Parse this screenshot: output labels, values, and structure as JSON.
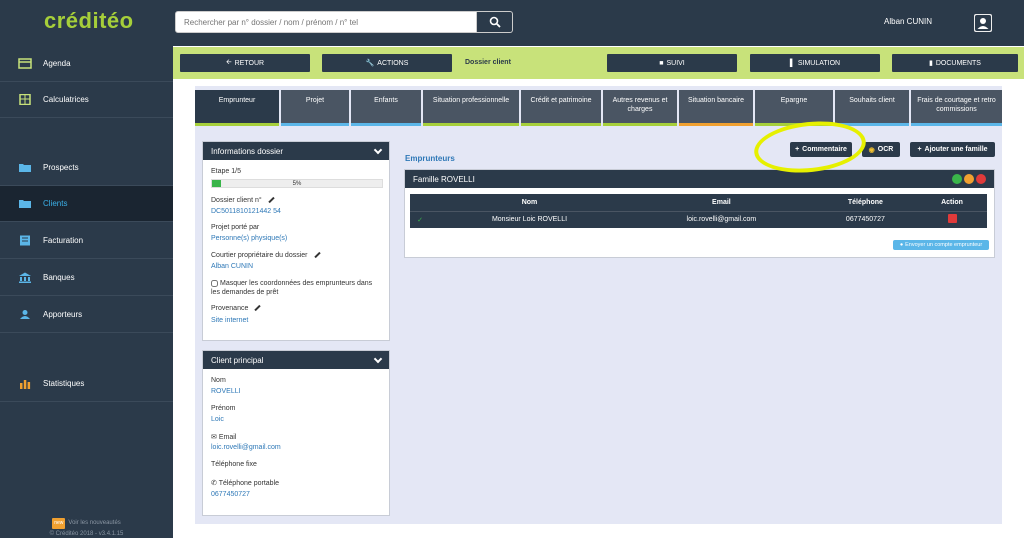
{
  "app": {
    "logo": "créditéo",
    "search_placeholder": "Rechercher par n° dossier / nom / prénom / n° tel",
    "user_name": "Alban CUNIN"
  },
  "sidebar": {
    "items": [
      {
        "label": "Agenda",
        "icon": "calendar-icon"
      },
      {
        "label": "Calculatrices",
        "icon": "calculator-icon"
      },
      {
        "label": "Prospects",
        "icon": "folder-icon"
      },
      {
        "label": "Clients",
        "icon": "folder-open-icon"
      },
      {
        "label": "Facturation",
        "icon": "invoice-icon"
      },
      {
        "label": "Banques",
        "icon": "bank-icon"
      },
      {
        "label": "Apporteurs",
        "icon": "handshake-icon"
      },
      {
        "label": "Statistiques",
        "icon": "bar-chart-icon"
      }
    ],
    "news_badge": "new",
    "news_label": "Voir les nouveautés",
    "copyright": "© Créditéo 2018 - v3.4.1.15"
  },
  "actionbar": {
    "retour": "RETOUR",
    "actions": "ACTIONS",
    "dossier": "Dossier client",
    "suivi": "SUIVI",
    "simulation": "SIMULATION",
    "documents": "DOCUMENTS"
  },
  "tabs": [
    "Emprunteur",
    "Projet",
    "Enfants",
    "Situation professionnelle",
    "Crédit et patrimoine",
    "Autres revenus et charges",
    "Situation bancaire",
    "Epargne",
    "Souhaits client",
    "Frais de courtage et retro commissions"
  ],
  "info_dossier": {
    "title": "Informations dossier",
    "etape": "Etape 1/5",
    "progress_percent": 5,
    "progress_label": "5%",
    "dossier_label": "Dossier client n°",
    "dossier_value": "DC5011810121442 54",
    "projet_label": "Projet porté par",
    "projet_value": "Personne(s) physique(s)",
    "courtier_label": "Courtier propriétaire du dossier",
    "courtier_value": "Alban CUNIN",
    "masquer_label": "Masquer les coordonnées des emprunteurs dans les demandes de prêt",
    "provenance_label": "Provenance",
    "provenance_value": "Site internet"
  },
  "client_principal": {
    "title": "Client principal",
    "nom_label": "Nom",
    "nom_value": "ROVELLI",
    "prenom_label": "Prénom",
    "prenom_value": "Loic",
    "email_label": "Email",
    "email_value": "loic.rovelli@gmail.com",
    "tel_fixe_label": "Téléphone fixe",
    "tel_port_label": "Téléphone portable",
    "tel_port_value": "0677450727"
  },
  "emprunteurs": {
    "title": "Emprunteurs",
    "commentaire_btn": "Commentaire",
    "ocr_btn": "OCR",
    "ajouter_btn": "Ajouter une famille",
    "famille_title": "Famille ROVELLI",
    "columns": [
      "Nom",
      "Email",
      "Téléphone",
      "Action"
    ],
    "rows": [
      {
        "nom": "Monsieur Loic ROVELLI",
        "email": "loic.rovelli@gmail.com",
        "tel": "0677450727"
      }
    ],
    "envoyer_btn": "Envoyer un compte emprunteur"
  },
  "colors": {
    "dark": "#2b3a4a",
    "accent_green": "#a6cf3a",
    "link_blue": "#2e78b7",
    "highlight_yellow": "#e6f000"
  }
}
